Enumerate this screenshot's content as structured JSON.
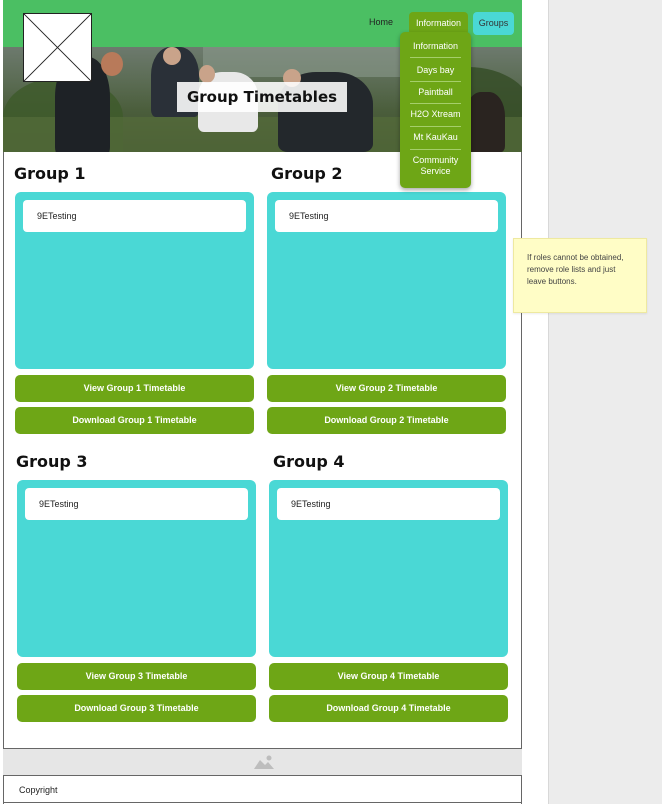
{
  "nav": {
    "home": "Home",
    "information": "Information",
    "groups": "Groups"
  },
  "hero": {
    "title": "Group Timetables"
  },
  "dropdown": {
    "items": [
      "Information",
      "Days bay",
      "Paintball",
      "H2O Xtream",
      "Mt KauKau",
      "Community Service"
    ]
  },
  "groups": [
    {
      "title": "Group 1",
      "role": "9ETesting",
      "view": "View Group 1 Timetable",
      "download": "Download Group 1 Timetable"
    },
    {
      "title": "Group 2",
      "role": "9ETesting",
      "view": "View Group 2 Timetable",
      "download": "Download Group 2 Timetable"
    },
    {
      "title": "Group 3",
      "role": "9ETesting",
      "view": "View Group 3 Timetable",
      "download": "Download Group 3 Timetable"
    },
    {
      "title": "Group 4",
      "role": "9ETesting",
      "view": "View Group 4 Timetable",
      "download": "Download Group 4 Timetable"
    }
  ],
  "footer": {
    "copyright": "Copyright",
    "image_icon": "image-placeholder-icon"
  },
  "note": {
    "text": "If roles cannot be obtained, remove role lists and just leave buttons."
  },
  "colors": {
    "header_green": "#4bbf63",
    "button_green": "#6ea616",
    "card_teal": "#4ad8d5",
    "sticky_yellow": "#fffdc6"
  }
}
